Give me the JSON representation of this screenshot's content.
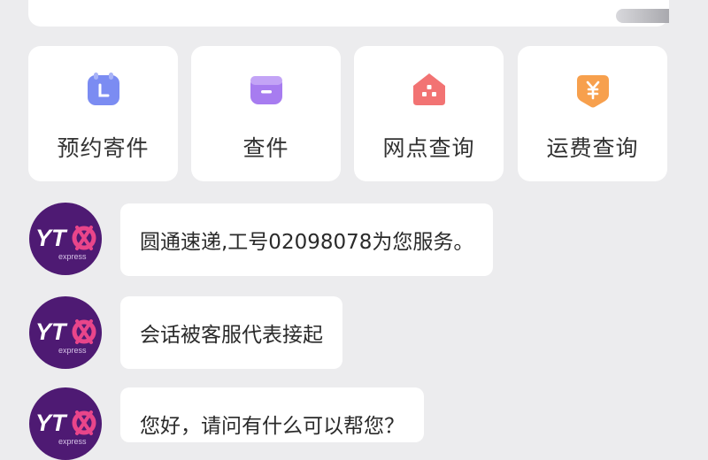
{
  "quick_actions": [
    {
      "label": "预约寄件",
      "icon": "calendar-icon",
      "color": "#7b8cf2"
    },
    {
      "label": "查件",
      "icon": "package-box-icon",
      "color": "#a77cf0"
    },
    {
      "label": "网点查询",
      "icon": "store-location-icon",
      "color": "#f27373"
    },
    {
      "label": "运费查询",
      "icon": "yuan-price-icon",
      "color": "#f7a04d"
    }
  ],
  "messages": [
    {
      "sender_logo": "YTO express",
      "text": "圆通速递,工号02098078为您服务。"
    },
    {
      "sender_logo": "YTO express",
      "text": "会话被客服代表接起"
    },
    {
      "sender_logo": "YTO express",
      "text": "您好，请问有什么可以帮您？"
    }
  ],
  "brand": {
    "logo_text": "YT",
    "logo_sub": "express",
    "primary": "#4e1a73",
    "accent": "#e9458a"
  }
}
